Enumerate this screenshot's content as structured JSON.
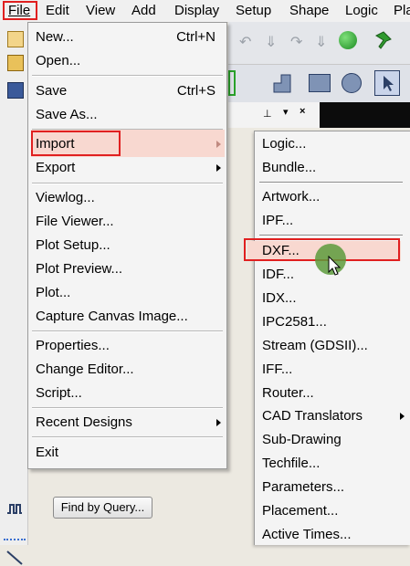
{
  "menubar": {
    "file": "File",
    "edit": "Edit",
    "view": "View",
    "add": "Add",
    "display": "Display",
    "setup": "Setup",
    "shape": "Shape",
    "logic": "Logic",
    "place": "Pla"
  },
  "file_menu": {
    "new": "New...",
    "new_shortcut": "Ctrl+N",
    "open": "Open...",
    "save": "Save",
    "save_shortcut": "Ctrl+S",
    "save_as": "Save As...",
    "import": "Import",
    "export": "Export",
    "viewlog": "Viewlog...",
    "file_viewer": "File Viewer...",
    "plot_setup": "Plot Setup...",
    "plot_preview": "Plot Preview...",
    "plot": "Plot...",
    "capture": "Capture Canvas Image...",
    "properties": "Properties...",
    "change_editor": "Change Editor...",
    "script": "Script...",
    "recent_designs": "Recent Designs",
    "exit": "Exit"
  },
  "import_menu": {
    "logic": "Logic...",
    "bundle": "Bundle...",
    "artwork": "Artwork...",
    "ipf": "IPF...",
    "dxf": "DXF...",
    "idf": "IDF...",
    "idx": "IDX...",
    "ipc2581": "IPC2581...",
    "stream": "Stream (GDSII)...",
    "iff": "IFF...",
    "router": "Router...",
    "cad_translators": "CAD Translators",
    "sub_drawing": "Sub-Drawing",
    "techfile": "Techfile...",
    "parameters": "Parameters...",
    "placement": "Placement...",
    "active_times": "Active Times..."
  },
  "find_by_query": "Find by Query...",
  "colors": {
    "highlight": "#f8d8d0",
    "annotation_red": "#e02020",
    "cursor_green": "#5d9b3c"
  }
}
